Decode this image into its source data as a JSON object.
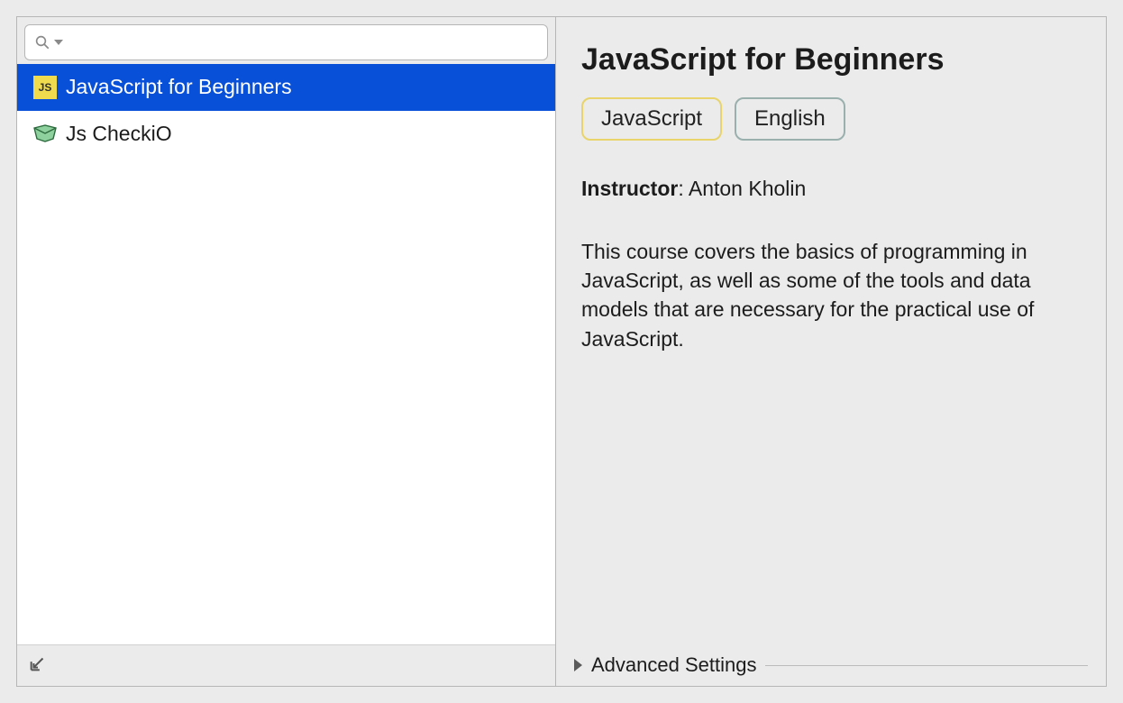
{
  "search": {
    "value": "",
    "placeholder": ""
  },
  "courses": [
    {
      "name": "JavaScript for Beginners",
      "icon": "js",
      "selected": true
    },
    {
      "name": "Js CheckiO",
      "icon": "checkio",
      "selected": false
    }
  ],
  "details": {
    "title": "JavaScript for Beginners",
    "tags": {
      "language": "JavaScript",
      "locale": "English"
    },
    "instructor_label": "Instructor",
    "instructor_name": "Anton Kholin",
    "description": "This course covers the basics of programming in JavaScript, as well as some of the tools and data models that are necessary for the practical use of JavaScript."
  },
  "advanced_settings_label": "Advanced Settings",
  "js_badge_text": "JS"
}
